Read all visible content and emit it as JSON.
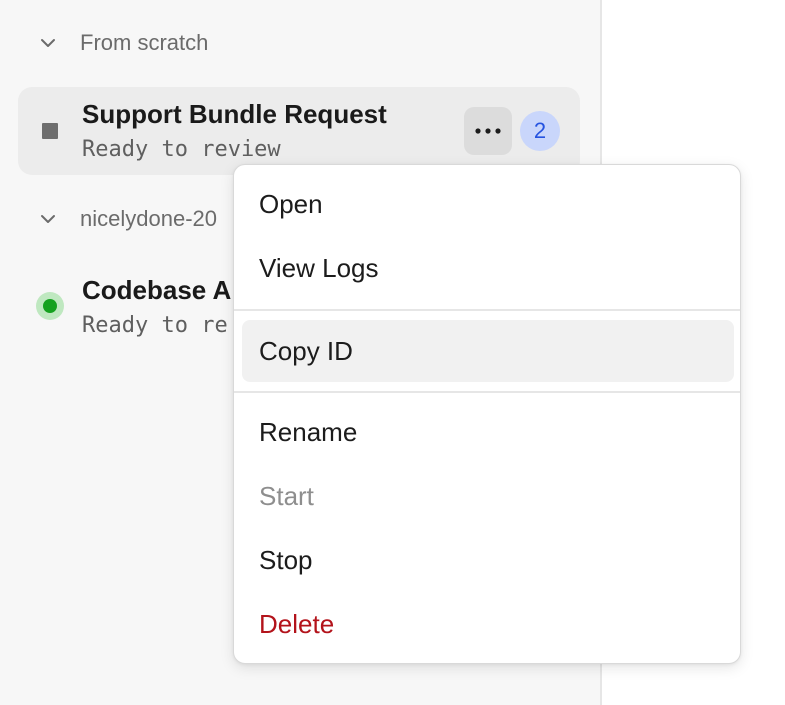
{
  "groups": [
    {
      "label": "From scratch",
      "tasks": [
        {
          "title": "Support Bundle Request",
          "status_text": "Ready to review",
          "status_icon": "stop-square-icon",
          "badge_count": "2"
        }
      ]
    },
    {
      "label": "nicelydone-20",
      "tasks": [
        {
          "title": "Codebase A",
          "status_text": "Ready to re",
          "status_icon": "running-dot-icon"
        }
      ]
    }
  ],
  "context_menu": {
    "items": [
      {
        "label": "Open"
      },
      {
        "label": "View Logs"
      },
      {
        "label": "Copy ID",
        "state": "highlighted"
      },
      {
        "label": "Rename"
      },
      {
        "label": "Start",
        "state": "disabled"
      },
      {
        "label": "Stop"
      },
      {
        "label": "Delete",
        "state": "danger"
      }
    ]
  },
  "colors": {
    "danger": "#b3131b",
    "badge_bg": "#c9d6fb",
    "badge_text": "#2553e0",
    "running": "#15a11f",
    "sidebar_bg": "#f7f7f7"
  }
}
